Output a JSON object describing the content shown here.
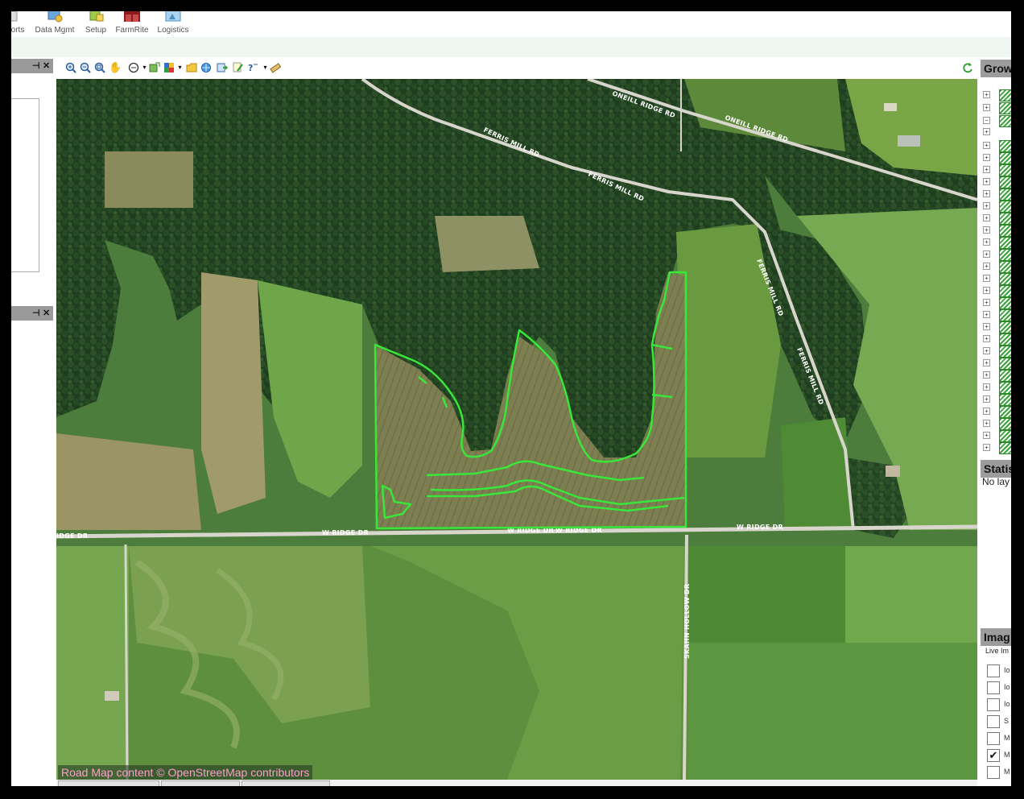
{
  "ribbon": {
    "items": [
      {
        "label": "orts",
        "icon": "reports-icon"
      },
      {
        "label": "Data Mgmt",
        "icon": "data-mgmt-icon"
      },
      {
        "label": "Setup",
        "icon": "setup-icon"
      },
      {
        "label": "FarmRite",
        "icon": "farmrite-icon"
      },
      {
        "label": "Logistics",
        "icon": "logistics-icon"
      }
    ]
  },
  "toolbar": {
    "tools": [
      "zoom-in-icon",
      "zoom-out-icon",
      "zoom-extent-icon",
      "pan-hand-icon",
      "select-icon",
      "add-layer-icon",
      "layer-style-icon",
      "open-folder-icon",
      "globe-icon",
      "export-icon",
      "edit-icon",
      "query-icon",
      "measure-icon"
    ],
    "refresh_icon": "refresh-icon"
  },
  "map": {
    "roads": {
      "oneill_ridge_1": "ONEILL RIDGE RD",
      "oneill_ridge_2": "ONEILL RIDGE RD",
      "ferris_mill_1": "FERRIS MILL RD",
      "ferris_mill_2": "FERRIS MILL RD",
      "ferris_mill_3": "FERRIS MILL RD",
      "ferris_mill_4": "FERRIS MILL RD",
      "w_ridge_left": "IDGE DR",
      "w_ridge_1": "W RIDGE DR",
      "w_ridge_2": "W RIDGE DR",
      "w_ridge_3": "W RIDGE DR",
      "w_ridge_4": "W RIDGE DR",
      "skahn_hollow": "SKAHN HOLLOW DR"
    },
    "attribution": "Road Map content © OpenStreetMap contributors",
    "field_outline_color": "#39e639"
  },
  "right_panel": {
    "grow_title": "Grow",
    "status_title": "Statis",
    "status_text": "No lay",
    "image_title": "Imag",
    "live_image_label": "Live Im",
    "image_layers": [
      {
        "label": "Io",
        "checked": false
      },
      {
        "label": "Io",
        "checked": false
      },
      {
        "label": "Io",
        "checked": false
      },
      {
        "label": "S",
        "checked": false
      },
      {
        "label": "M",
        "checked": false
      },
      {
        "label": "M",
        "checked": true
      },
      {
        "label": "M",
        "checked": false
      }
    ]
  },
  "left_panel": {
    "pin_icon": "pin-icon",
    "close_icon": "close-icon"
  }
}
